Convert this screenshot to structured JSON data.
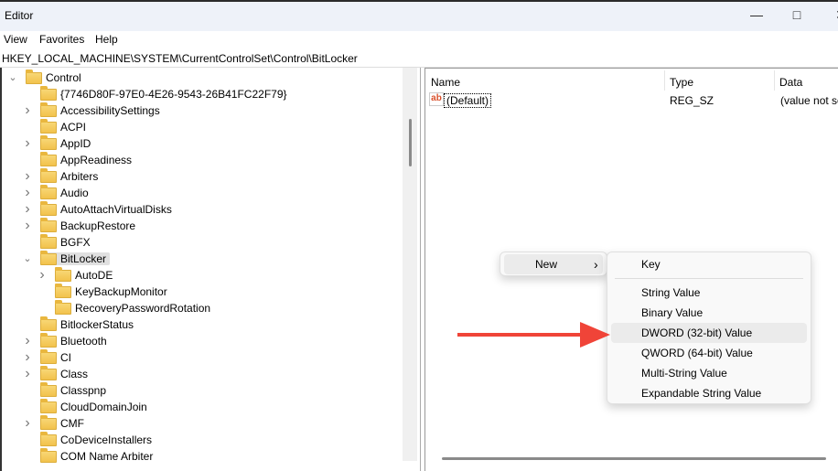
{
  "window": {
    "title": "Editor",
    "minimize_icon": "minimize-icon",
    "maximize_icon": "maximize-icon",
    "close_icon": "close-icon"
  },
  "menu": [
    "View",
    "Favorites",
    "Help"
  ],
  "address": "HKEY_LOCAL_MACHINE\\SYSTEM\\CurrentControlSet\\Control\\BitLocker",
  "tree": [
    {
      "label": "Control",
      "level": 0,
      "expander": "expanded"
    },
    {
      "label": "{7746D80F-97E0-4E26-9543-26B41FC22F79}",
      "level": 1,
      "expander": "none"
    },
    {
      "label": "AccessibilitySettings",
      "level": 1,
      "expander": "collapsed"
    },
    {
      "label": "ACPI",
      "level": 1,
      "expander": "none"
    },
    {
      "label": "AppID",
      "level": 1,
      "expander": "collapsed"
    },
    {
      "label": "AppReadiness",
      "level": 1,
      "expander": "none"
    },
    {
      "label": "Arbiters",
      "level": 1,
      "expander": "collapsed"
    },
    {
      "label": "Audio",
      "level": 1,
      "expander": "collapsed"
    },
    {
      "label": "AutoAttachVirtualDisks",
      "level": 1,
      "expander": "collapsed"
    },
    {
      "label": "BackupRestore",
      "level": 1,
      "expander": "collapsed"
    },
    {
      "label": "BGFX",
      "level": 1,
      "expander": "none"
    },
    {
      "label": "BitLocker",
      "level": 1,
      "expander": "expanded",
      "selected": true
    },
    {
      "label": "AutoDE",
      "level": 2,
      "expander": "collapsed"
    },
    {
      "label": "KeyBackupMonitor",
      "level": 2,
      "expander": "none"
    },
    {
      "label": "RecoveryPasswordRotation",
      "level": 2,
      "expander": "none"
    },
    {
      "label": "BitlockerStatus",
      "level": 1,
      "expander": "none"
    },
    {
      "label": "Bluetooth",
      "level": 1,
      "expander": "collapsed"
    },
    {
      "label": "CI",
      "level": 1,
      "expander": "collapsed"
    },
    {
      "label": "Class",
      "level": 1,
      "expander": "collapsed"
    },
    {
      "label": "Classpnp",
      "level": 1,
      "expander": "none"
    },
    {
      "label": "CloudDomainJoin",
      "level": 1,
      "expander": "none"
    },
    {
      "label": "CMF",
      "level": 1,
      "expander": "collapsed"
    },
    {
      "label": "CoDeviceInstallers",
      "level": 1,
      "expander": "none"
    },
    {
      "label": "COM Name Arbiter",
      "level": 1,
      "expander": "none"
    }
  ],
  "values": {
    "columns": [
      "Name",
      "Type",
      "Data"
    ],
    "rows": [
      {
        "name": "(Default)",
        "type": "REG_SZ",
        "data": "(value not se",
        "icon": "string-value-icon"
      }
    ]
  },
  "context_menu": {
    "new_label": "New",
    "chevron": "›"
  },
  "submenu": {
    "items": [
      "Key",
      "String Value",
      "Binary Value",
      "DWORD (32-bit) Value",
      "QWORD (64-bit) Value",
      "Multi-String Value",
      "Expandable String Value"
    ],
    "highlighted": "DWORD (32-bit) Value"
  },
  "annotation": {
    "arrow_color": "#f04438"
  }
}
